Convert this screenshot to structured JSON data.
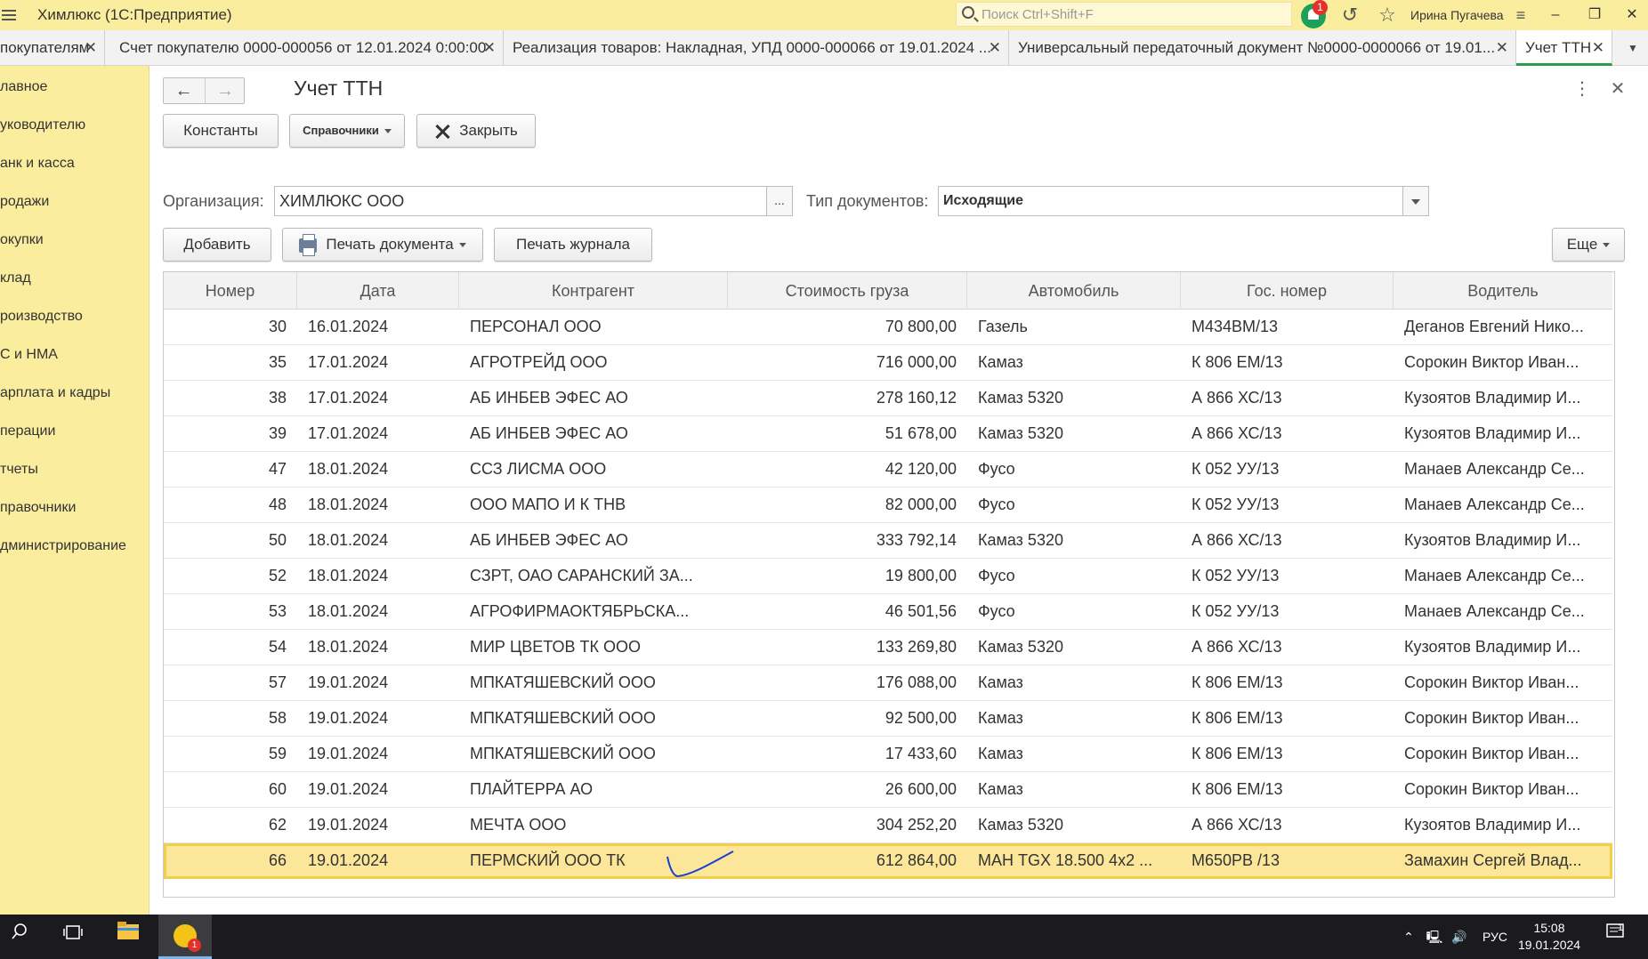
{
  "window": {
    "title": "Химлюкс  (1С:Предприятие)",
    "search_placeholder": "Поиск Ctrl+Shift+F",
    "notifications_count": "1",
    "user": "Ирина Пугачева"
  },
  "tabs": [
    {
      "label": "покупателям"
    },
    {
      "label": "Счет покупателю 0000-000056 от 12.01.2024 0:00:00"
    },
    {
      "label": "Реализация товаров: Накладная, УПД 0000-000066 от 19.01.2024 ..."
    },
    {
      "label": "Универсальный передаточный документ №0000-0000066 от 19.01..."
    },
    {
      "label": "Учет ТТН",
      "active": true
    }
  ],
  "sidebar": {
    "items": [
      {
        "label": "лавное"
      },
      {
        "label": "уководителю"
      },
      {
        "label": "анк и касса"
      },
      {
        "label": "родажи"
      },
      {
        "label": "окупки"
      },
      {
        "label": "клад"
      },
      {
        "label": "роизводство"
      },
      {
        "label": "С и НМА"
      },
      {
        "label": "арплата и кадры"
      },
      {
        "label": "перации"
      },
      {
        "label": "тчеты"
      },
      {
        "label": "правочники"
      },
      {
        "label": "дминистрирование"
      }
    ]
  },
  "form": {
    "title": "Учет ТТН",
    "toolbar": {
      "constants": "Константы",
      "references": "Справочники",
      "close": "Закрыть"
    },
    "org_label": "Организация:",
    "org_value": "ХИМЛЮКС ООО",
    "org_select": "...",
    "doc_type_label": "Тип документов:",
    "doc_type_value": "Исходящие",
    "list_toolbar": {
      "add": "Добавить",
      "print_doc": "Печать документа",
      "print_journal": "Печать журнала",
      "more": "Еще"
    }
  },
  "table": {
    "columns": [
      "Номер",
      "Дата",
      "Контрагент",
      "Стоимость груза",
      "Автомобиль",
      "Гос. номер",
      "Водитель"
    ],
    "rows": [
      [
        "30",
        "16.01.2024",
        "ПЕРСОНАЛ ООО",
        "70 800,00",
        "Газель",
        "М434ВМ/13",
        "Деганов Евгений Нико..."
      ],
      [
        "35",
        "17.01.2024",
        "АГРОТРЕЙД ООО",
        "716 000,00",
        "Камаз",
        "К 806 ЕМ/13",
        "Сорокин Виктор Иван..."
      ],
      [
        "38",
        "17.01.2024",
        "АБ ИНБЕВ ЭФЕС АО",
        "278 160,12",
        "Камаз 5320",
        "А 866 ХС/13",
        "Кузоятов Владимир И..."
      ],
      [
        "39",
        "17.01.2024",
        "АБ ИНБЕВ ЭФЕС АО",
        "51 678,00",
        "Камаз 5320",
        "А 866 ХС/13",
        "Кузоятов Владимир И..."
      ],
      [
        "47",
        "18.01.2024",
        "ССЗ ЛИСМА ООО",
        "42 120,00",
        "Фусо",
        "К 052 УУ/13",
        "Манаев Александр Се..."
      ],
      [
        "48",
        "18.01.2024",
        "ООО МАПО И К ТНВ",
        "82 000,00",
        "Фусо",
        "К 052 УУ/13",
        "Манаев Александр Се..."
      ],
      [
        "50",
        "18.01.2024",
        "АБ ИНБЕВ ЭФЕС АО",
        "333 792,14",
        "Камаз 5320",
        "А 866 ХС/13",
        "Кузоятов Владимир И..."
      ],
      [
        "52",
        "18.01.2024",
        "СЗРТ, ОАО САРАНСКИЙ ЗА...",
        "19 800,00",
        "Фусо",
        "К 052 УУ/13",
        "Манаев Александр Се..."
      ],
      [
        "53",
        "18.01.2024",
        "АГРОФИРМАОКТЯБРЬСКА...",
        "46 501,56",
        "Фусо",
        "К 052 УУ/13",
        "Манаев Александр Се..."
      ],
      [
        "54",
        "18.01.2024",
        "МИР ЦВЕТОВ ТК ООО",
        "133 269,80",
        "Камаз 5320",
        "А 866 ХС/13",
        "Кузоятов Владимир И..."
      ],
      [
        "57",
        "19.01.2024",
        "МПКАТЯШЕВСКИЙ ООО",
        "176 088,00",
        "Камаз",
        "К 806 ЕМ/13",
        "Сорокин Виктор Иван..."
      ],
      [
        "58",
        "19.01.2024",
        "МПКАТЯШЕВСКИЙ ООО",
        "92 500,00",
        "Камаз",
        "К 806 ЕМ/13",
        "Сорокин Виктор Иван..."
      ],
      [
        "59",
        "19.01.2024",
        "МПКАТЯШЕВСКИЙ ООО",
        "17 433,60",
        "Камаз",
        "К 806 ЕМ/13",
        "Сорокин Виктор Иван..."
      ],
      [
        "60",
        "19.01.2024",
        "ПЛАЙТЕРРА АО",
        "26 600,00",
        "Камаз",
        "К 806 ЕМ/13",
        "Сорокин Виктор Иван..."
      ],
      [
        "62",
        "19.01.2024",
        "МЕЧТА ООО",
        "304 252,20",
        "Камаз 5320",
        "А 866 ХС/13",
        "Кузоятов Владимир И..."
      ],
      [
        "66",
        "19.01.2024",
        "ПЕРМСКИЙ ООО ТК",
        "612 864,00",
        "МАН TGX 18.500 4х2 ...",
        "М650РВ /13",
        "Замахин Сергей Влад..."
      ]
    ],
    "selected_row": 15
  },
  "taskbar": {
    "lang": "РУС",
    "time": "15:08",
    "date": "19.01.2024",
    "app_badge": "1",
    "notif_count": "1"
  },
  "colors": {
    "accent_yellow": "#fbed9e",
    "active_tab": "#2d9c4a",
    "selected_row": "#fbe69a"
  }
}
